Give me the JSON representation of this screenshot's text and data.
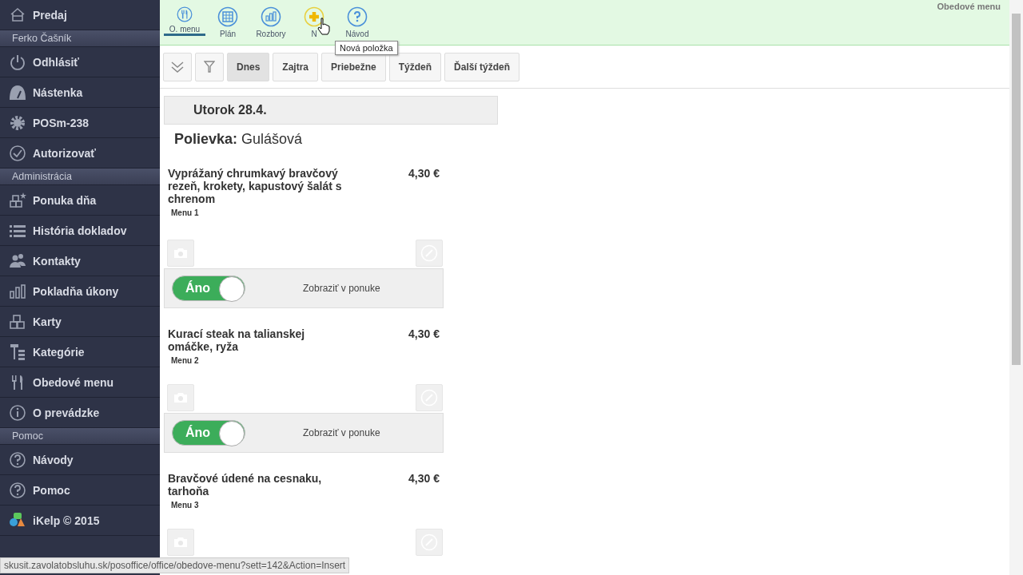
{
  "sidebar": {
    "items": [
      {
        "kind": "item",
        "label": "Predaj"
      },
      {
        "kind": "header",
        "label": "Ferko Čašník"
      },
      {
        "kind": "item",
        "label": "Odhlásiť"
      },
      {
        "kind": "item",
        "label": "Nástenka"
      },
      {
        "kind": "item",
        "label": "POSm-238"
      },
      {
        "kind": "item",
        "label": "Autorizovať"
      },
      {
        "kind": "header",
        "label": "Administrácia"
      },
      {
        "kind": "item",
        "label": "Ponuka dňa"
      },
      {
        "kind": "item",
        "label": "História dokladov"
      },
      {
        "kind": "item",
        "label": "Kontakty"
      },
      {
        "kind": "item",
        "label": "Pokladňa úkony"
      },
      {
        "kind": "item",
        "label": "Karty"
      },
      {
        "kind": "item",
        "label": "Kategórie"
      },
      {
        "kind": "item",
        "label": "Obedové menu"
      },
      {
        "kind": "item",
        "label": "O prevádzke"
      },
      {
        "kind": "header",
        "label": "Pomoc"
      },
      {
        "kind": "item",
        "label": "Návody"
      },
      {
        "kind": "item",
        "label": "Pomoc"
      },
      {
        "kind": "item",
        "label": "iKelp © 2015"
      }
    ]
  },
  "toolbar": {
    "tabs": [
      {
        "label": "O. menu",
        "selected": true
      },
      {
        "label": "Plán",
        "selected": false
      },
      {
        "label": "Rozbory",
        "selected": false
      },
      {
        "label": "N",
        "selected": false,
        "hovered": true
      },
      {
        "label": "Návod",
        "selected": false
      }
    ],
    "tooltip": "Nová položka",
    "page_title": "Obedové menu"
  },
  "filters": [
    {
      "label": "Dnes",
      "selected": true
    },
    {
      "label": "Zajtra",
      "selected": false
    },
    {
      "label": "Priebežne",
      "selected": false
    },
    {
      "label": "Týždeň",
      "selected": false
    },
    {
      "label": "Ďalší týždeň",
      "selected": false
    }
  ],
  "day": {
    "title": "Utorok 28.4.",
    "soup_label": "Polievka:",
    "soup": "Gulášová"
  },
  "dishes": [
    {
      "name": "Vyprážaný chrumkavý bravčový rezeň, krokety, kapustový šalát s chrenom",
      "price": "4,30 €",
      "menu": "Menu 1",
      "toggle": {
        "on": true,
        "label": "Áno",
        "caption": "Zobraziť v ponuke"
      }
    },
    {
      "name": "Kurací steak na talianskej omáčke, ryža",
      "price": "4,30 €",
      "menu": "Menu 2",
      "toggle": {
        "on": true,
        "label": "Áno",
        "caption": "Zobraziť v ponuke"
      }
    },
    {
      "name": "Bravčové údené na cesnaku, tarhoňa",
      "price": "4,30 €",
      "menu": "Menu 3"
    }
  ],
  "status_bar": {
    "url": "skusit.zavolatobsluhu.sk/posoffice/office/obedove-menu?sett=142&Action=Insert"
  }
}
